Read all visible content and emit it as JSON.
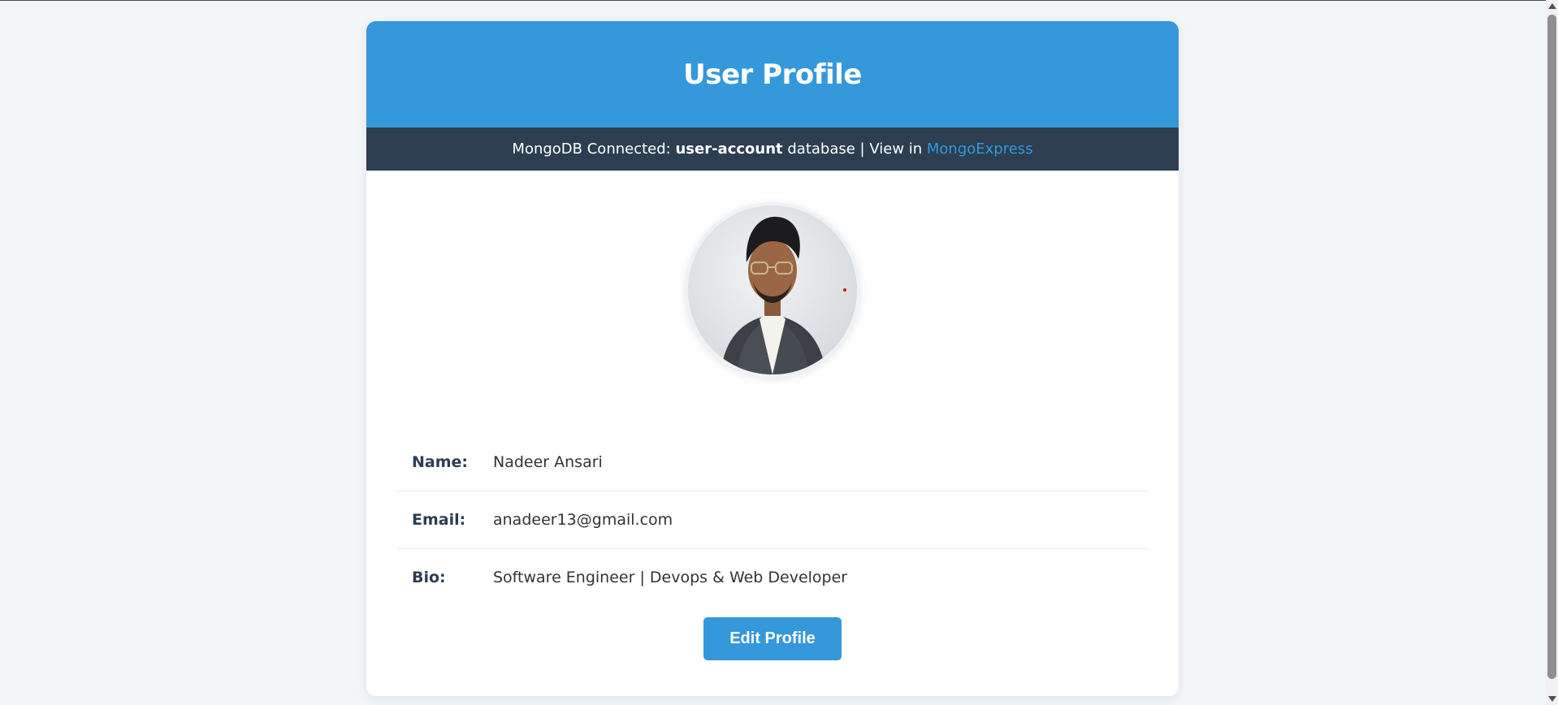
{
  "header": {
    "title": "User Profile"
  },
  "status": {
    "prefix": "MongoDB Connected: ",
    "database": "user-account",
    "middle": " database | View in ",
    "link_label": "MongoExpress"
  },
  "avatar": {
    "icon": "profile-photo"
  },
  "profile": {
    "fields": [
      {
        "label": "Name:",
        "value": "Nadeer Ansari"
      },
      {
        "label": "Email:",
        "value": "anadeer13@gmail.com"
      },
      {
        "label": "Bio:",
        "value": "Software Engineer | Devops & Web Developer"
      }
    ]
  },
  "actions": {
    "edit_label": "Edit Profile"
  },
  "colors": {
    "accent": "#3498db",
    "status_bar": "#2c3e50",
    "page_background": "#f3f6f9"
  }
}
